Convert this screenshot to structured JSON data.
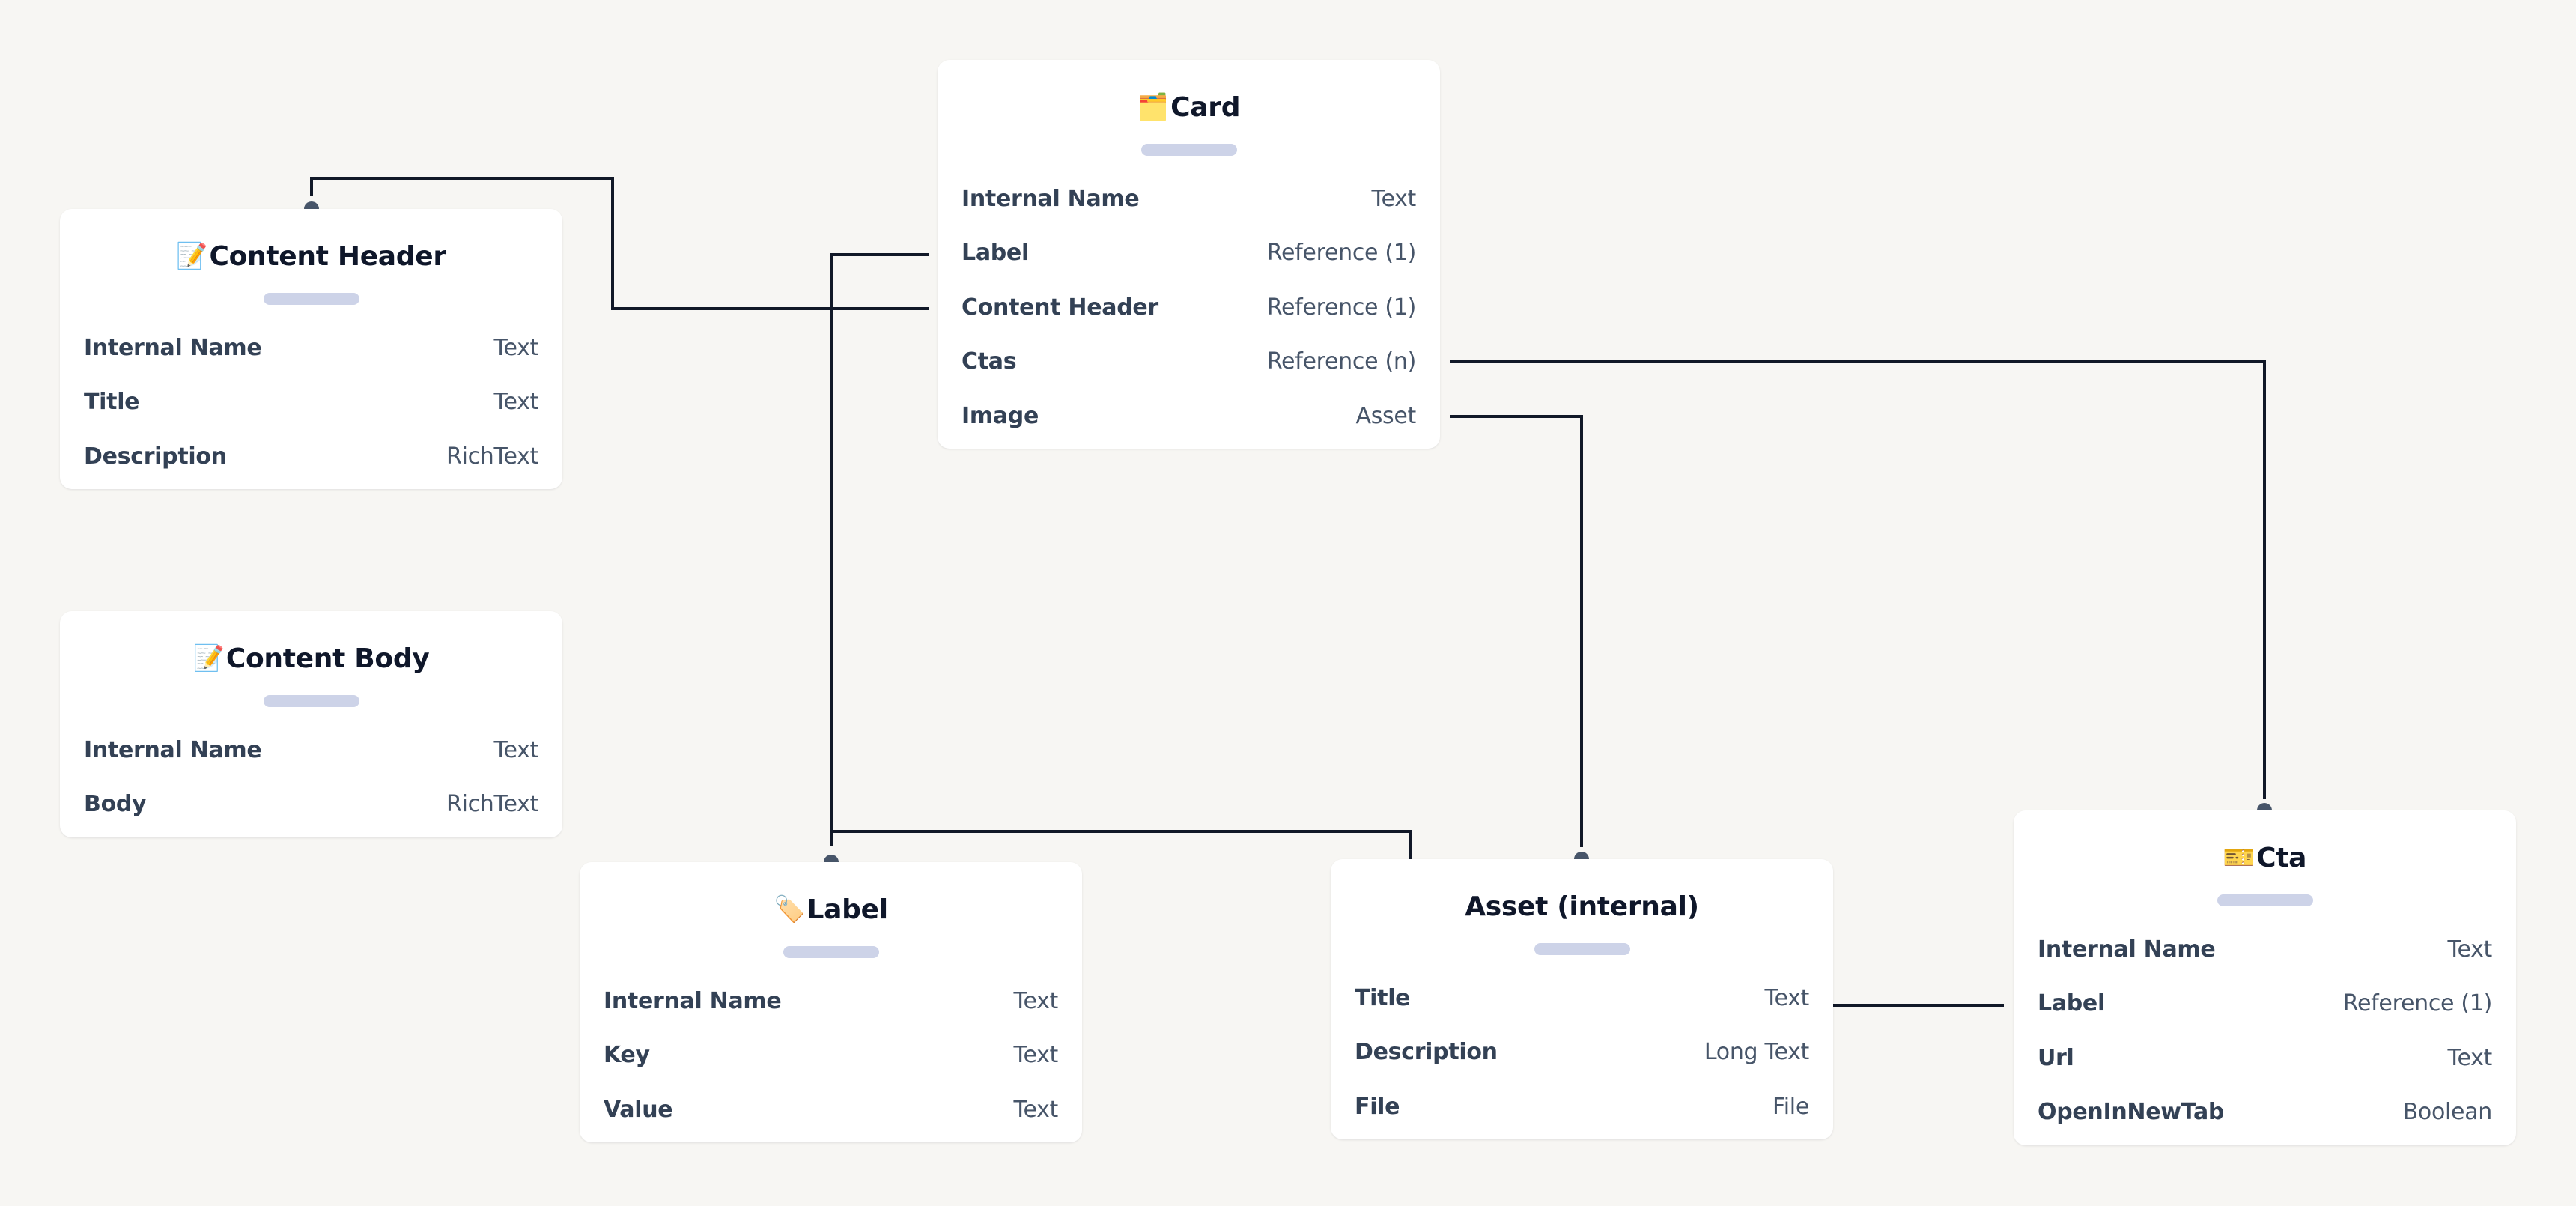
{
  "colors": {
    "background": "#F7F6F3",
    "card": "#FFFFFF",
    "title": "#0F172A",
    "field_name": "#334155",
    "field_type": "#475569",
    "connector": "#111827",
    "endpoint": "#475569",
    "placeholder_bar": "#CDD3E8"
  },
  "entities": [
    {
      "id": "content-header",
      "icon": "memo-icon",
      "glyph": "📝",
      "title": "Content Header",
      "fields": [
        {
          "name": "Internal Name",
          "type": "Text"
        },
        {
          "name": "Title",
          "type": "Text"
        },
        {
          "name": "Description",
          "type": "RichText"
        }
      ]
    },
    {
      "id": "content-body",
      "icon": "memo-icon",
      "glyph": "📝",
      "title": "Content Body",
      "fields": [
        {
          "name": "Internal Name",
          "type": "Text"
        },
        {
          "name": "Body",
          "type": "RichText"
        }
      ]
    },
    {
      "id": "card",
      "icon": "card-index-dividers-icon",
      "glyph": "🗂️",
      "title": "Card",
      "fields": [
        {
          "name": "Internal Name",
          "type": "Text"
        },
        {
          "name": "Label",
          "type": "Reference (1)"
        },
        {
          "name": "Content Header",
          "type": "Reference (1)"
        },
        {
          "name": "Ctas",
          "type": "Reference (n)"
        },
        {
          "name": "Image",
          "type": "Asset"
        }
      ]
    },
    {
      "id": "label",
      "icon": "label-tag-icon",
      "glyph": "🏷️",
      "title": "Label",
      "fields": [
        {
          "name": "Internal Name",
          "type": "Text"
        },
        {
          "name": "Key",
          "type": "Text"
        },
        {
          "name": "Value",
          "type": "Text"
        }
      ]
    },
    {
      "id": "asset",
      "icon": "",
      "glyph": "",
      "title": "Asset (internal)",
      "fields": [
        {
          "name": "Title",
          "type": "Text"
        },
        {
          "name": "Description",
          "type": "Long Text"
        },
        {
          "name": "File",
          "type": "File"
        }
      ]
    },
    {
      "id": "cta",
      "icon": "ticket-icon",
      "glyph": "🎫",
      "title": "Cta",
      "fields": [
        {
          "name": "Internal Name",
          "type": "Text"
        },
        {
          "name": "Label",
          "type": "Reference (1)"
        },
        {
          "name": "Url",
          "type": "Text"
        },
        {
          "name": "OpenInNewTab",
          "type": "Boolean"
        }
      ]
    }
  ],
  "relations": [
    {
      "from": "card",
      "field": "Label",
      "to": "label"
    },
    {
      "from": "card",
      "field": "Content Header",
      "to": "content-header"
    },
    {
      "from": "card",
      "field": "Ctas",
      "to": "cta"
    },
    {
      "from": "card",
      "field": "Image",
      "to": "asset"
    },
    {
      "from": "cta",
      "field": "Label",
      "to": "label"
    },
    {
      "from": "asset",
      "field": "Title",
      "to": "cta"
    }
  ]
}
